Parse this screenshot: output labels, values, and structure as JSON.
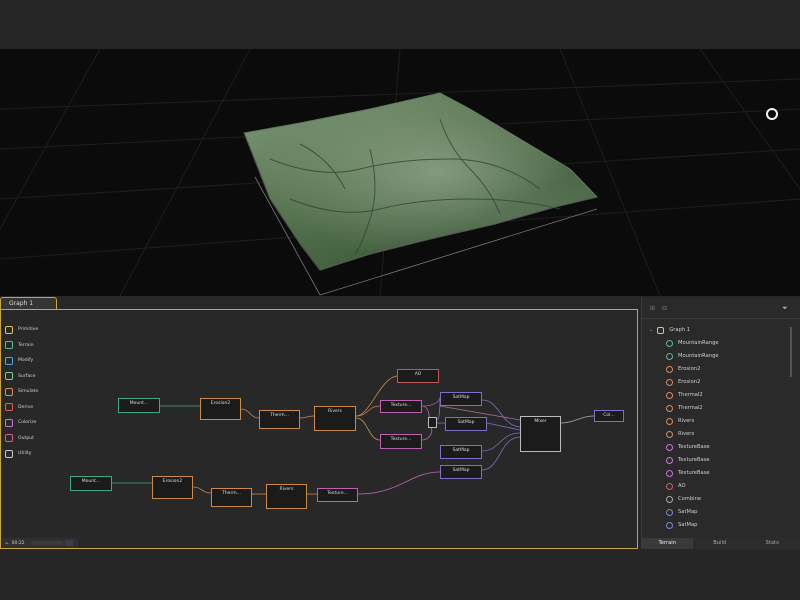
{
  "graph_tab": "Graph 1",
  "palette": [
    {
      "label": "Primitive",
      "icon": "cube-icon",
      "color": "#e6c45a"
    },
    {
      "label": "Terrain",
      "icon": "mountain-icon",
      "color": "#5ab8a0"
    },
    {
      "label": "Modify",
      "icon": "modify-icon",
      "color": "#5aa8d8"
    },
    {
      "label": "Surface",
      "icon": "surface-icon",
      "color": "#7ad08a"
    },
    {
      "label": "Simulate",
      "icon": "simulate-icon",
      "color": "#e08a5a"
    },
    {
      "label": "Derive",
      "icon": "derive-icon",
      "color": "#e05a5a"
    },
    {
      "label": "Colorize",
      "icon": "colorize-icon",
      "color": "#c878d8"
    },
    {
      "label": "Output",
      "icon": "output-icon",
      "color": "#d85a8a"
    },
    {
      "label": "Utility",
      "icon": "utility-icon",
      "color": "#cccccc"
    }
  ],
  "nodes": {
    "mount1": "Mount...",
    "erosion1": "Erosion2",
    "therm1": "Therm...",
    "rivers1": "Rivers",
    "ao": "AO",
    "texture1": "Texture...",
    "texture2": "Texture...",
    "satmap1": "SatMap",
    "satmap2": "SatMap",
    "satmap3": "SatMap",
    "satmap4": "SatMap",
    "mixer": "Mixer",
    "col": "Col...",
    "mount2": "Mount...",
    "erosion2": "Erosion2",
    "therm2": "Therm...",
    "rivers2": "Rivers",
    "texture3": "Texture..."
  },
  "status": {
    "time": "00:22"
  },
  "right_panel": {
    "root": "Graph 1",
    "items": [
      {
        "label": "MountainRange",
        "icon": "mountain-icon",
        "color": "#5ab8a0"
      },
      {
        "label": "MountainRange",
        "icon": "mountain-icon",
        "color": "#5ab8a0"
      },
      {
        "label": "Erosion2",
        "icon": "erosion-icon",
        "color": "#e08a5a"
      },
      {
        "label": "Erosion2",
        "icon": "erosion-icon",
        "color": "#e08a5a"
      },
      {
        "label": "Thermal2",
        "icon": "thermal-icon",
        "color": "#e08a5a"
      },
      {
        "label": "Thermal2",
        "icon": "thermal-icon",
        "color": "#e08a5a"
      },
      {
        "label": "Rivers",
        "icon": "rivers-icon",
        "color": "#e08a5a"
      },
      {
        "label": "Rivers",
        "icon": "rivers-icon",
        "color": "#e08a5a"
      },
      {
        "label": "TextureBase",
        "icon": "texture-icon",
        "color": "#c878d8"
      },
      {
        "label": "TextureBase",
        "icon": "texture-icon",
        "color": "#c878d8"
      },
      {
        "label": "TextureBase",
        "icon": "texture-icon",
        "color": "#c878d8"
      },
      {
        "label": "AO",
        "icon": "ao-icon",
        "color": "#e05a5a"
      },
      {
        "label": "Combine",
        "icon": "combine-icon",
        "color": "#aaaaaa"
      },
      {
        "label": "SatMap",
        "icon": "satmap-icon",
        "color": "#7a86d8"
      },
      {
        "label": "SatMap",
        "icon": "satmap-icon",
        "color": "#7a86d8"
      }
    ]
  },
  "bottom_tabs": [
    "Terrain",
    "Build",
    "Stats"
  ]
}
